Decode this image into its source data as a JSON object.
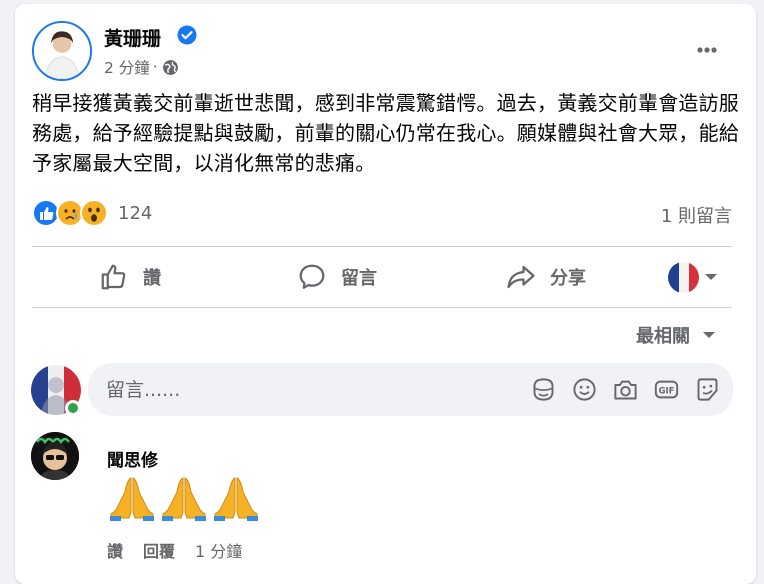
{
  "post": {
    "author": "黃珊珊",
    "time": "2 分鐘",
    "dot": "·",
    "text": "稍早接獲黃義交前輩逝世悲聞，感到非常震驚錯愕。過去，黃義交前輩會造訪服務處，給予經驗提點與鼓勵，前輩的關心仍常在我心。願媒體與社會大眾，能給予家屬最大空間，以消化無常的悲痛。",
    "reaction_count": "124",
    "comment_count": "1 則留言"
  },
  "actions": {
    "like": "讚",
    "comment": "留言",
    "share": "分享"
  },
  "sort": {
    "label": "最相關"
  },
  "composer": {
    "placeholder": "留言......"
  },
  "comment": {
    "author": "聞思修",
    "like": "讚",
    "reply": "回覆",
    "time": "1 分鐘"
  },
  "colors": {
    "accent": "#1877f2",
    "muted": "#65676b",
    "divider": "#ced0d4"
  },
  "icons": [
    "verified-icon",
    "globe-icon",
    "more-icon",
    "like-icon",
    "comment-icon",
    "share-icon",
    "sticker-icon",
    "smiley-icon",
    "camera-icon",
    "gif-icon",
    "sticker-face-icon",
    "praying-hands-icon"
  ]
}
